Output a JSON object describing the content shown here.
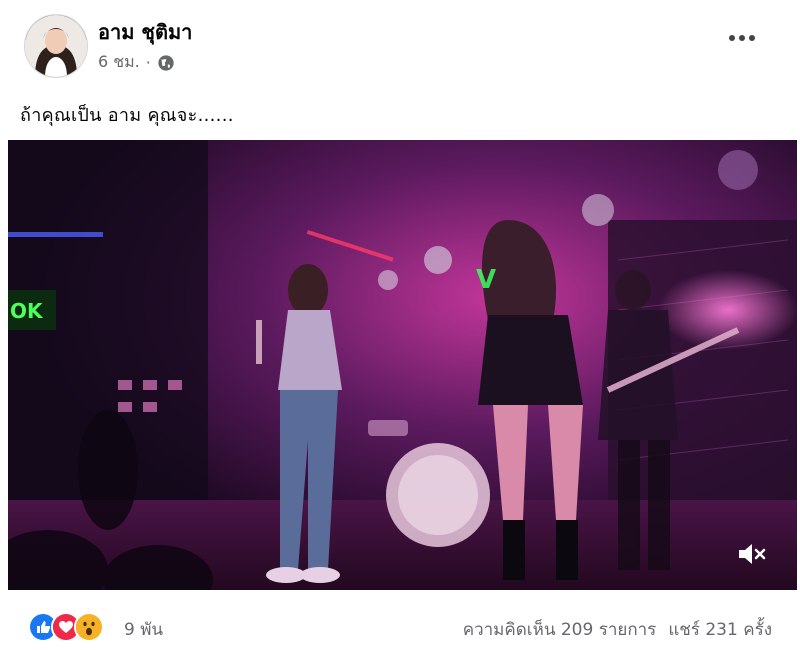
{
  "post": {
    "author": "อาม ชุติมา",
    "time": "6 ชม.",
    "separator": "·",
    "caption": "ถ้าคุณเป็น อาม คุณจะ......",
    "more_icon": "more-options-icon",
    "privacy_icon": "globe-icon",
    "mute_icon": "speaker-muted-icon"
  },
  "footer": {
    "reaction_icons": [
      "like-icon",
      "love-icon",
      "wow-icon"
    ],
    "reaction_count": "9 พัน",
    "comments": "ความคิดเห็น 209 รายการ",
    "shares": "แชร์ 231 ครั้ง"
  },
  "colors": {
    "like": "#1877f2",
    "love": "#f02849",
    "wow": "#f7b125",
    "muted_text": "#65676b"
  }
}
